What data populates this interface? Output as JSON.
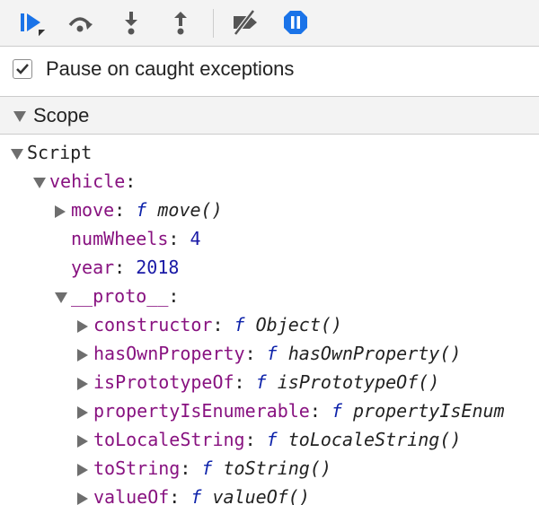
{
  "toolbar": {
    "buttons": [
      {
        "id": "resume",
        "icon": "resume-icon"
      },
      {
        "id": "step-over",
        "icon": "step-over-icon"
      },
      {
        "id": "step-into",
        "icon": "step-into-icon"
      },
      {
        "id": "step-out",
        "icon": "step-out-icon"
      },
      {
        "id": "deactivate-breakpoints",
        "icon": "deactivate-breakpoints-icon"
      },
      {
        "id": "pause-on-exceptions",
        "icon": "pause-on-exceptions-icon"
      }
    ],
    "accent": "#1a73e8"
  },
  "pause_caught": {
    "label": "Pause on caught exceptions",
    "checked": true
  },
  "scope": {
    "title": "Scope"
  },
  "tree": {
    "script": "Script",
    "vehicle": "vehicle",
    "move_key": "move",
    "move_f": "f",
    "move_val": "move()",
    "numWheels_key": "numWheels",
    "numWheels_val": "4",
    "year_key": "year",
    "year_val": "2018",
    "proto_key": "__proto__",
    "protos": [
      {
        "key": "constructor",
        "f": "f",
        "val": "Object()"
      },
      {
        "key": "hasOwnProperty",
        "f": "f",
        "val": "hasOwnProperty()"
      },
      {
        "key": "isPrototypeOf",
        "f": "f",
        "val": "isPrototypeOf()"
      },
      {
        "key": "propertyIsEnumerable",
        "f": "f",
        "val": "propertyIsEnum"
      },
      {
        "key": "toLocaleString",
        "f": "f",
        "val": "toLocaleString()"
      },
      {
        "key": "toString",
        "f": "f",
        "val": "toString()"
      },
      {
        "key": "valueOf",
        "f": "f",
        "val": "valueOf()"
      }
    ],
    "colon": ":"
  }
}
